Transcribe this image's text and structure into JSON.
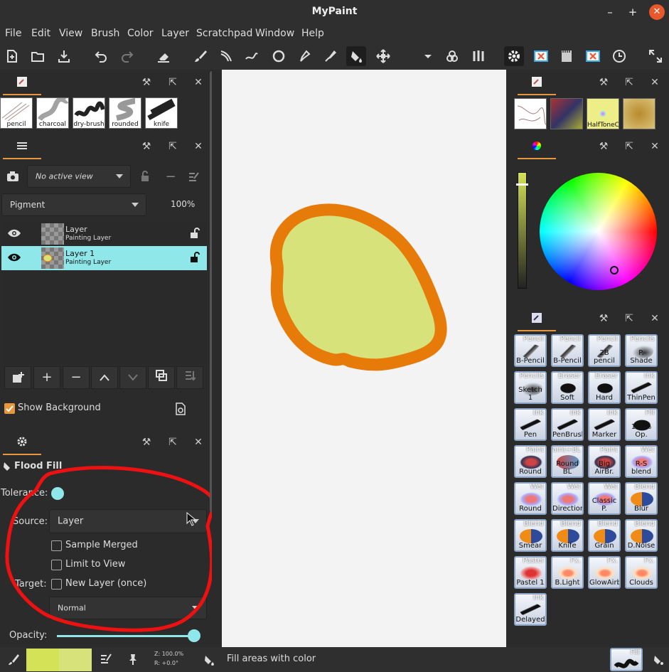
{
  "window": {
    "title": "MyPaint",
    "min": "–",
    "max": "+",
    "close": "✕"
  },
  "menu": [
    "File",
    "Edit",
    "View",
    "Brush",
    "Color",
    "Layer",
    "Scratchpad",
    "Window",
    "Help"
  ],
  "brushes_top": [
    {
      "label": "pencil"
    },
    {
      "label": "charcoal"
    },
    {
      "label": "dry-brush"
    },
    {
      "label": "rounded"
    },
    {
      "label": "knife"
    }
  ],
  "right_brushes_top": [
    {
      "label": ""
    },
    {
      "label": ""
    },
    {
      "label": "HalfToneCMY"
    },
    {
      "label": ""
    }
  ],
  "layers": {
    "view_combo": "No active view",
    "blend_mode": "Pigment",
    "opacity": "100%",
    "items": [
      {
        "name": "Layer",
        "type": "Painting Layer",
        "selected": false
      },
      {
        "name": "Layer 1",
        "type": "Painting Layer",
        "selected": true
      }
    ],
    "show_background": "Show Background"
  },
  "tool_options": {
    "title": "Flood Fill",
    "tolerance_label": "Tolerance:",
    "tolerance_value": 0.0,
    "source_label": "Source:",
    "source_value": "Layer",
    "sample_merged": "Sample Merged",
    "limit_to_view": "Limit to View",
    "target_label": "Target:",
    "new_layer": "New Layer (once)",
    "mode_value": "Normal",
    "opacity_label": "Opacity:",
    "opacity_value": 1.0
  },
  "brush_grid": [
    {
      "group": "Pencil",
      "name": "B-Pencil"
    },
    {
      "group": "Pencil",
      "name": "B-Pencil"
    },
    {
      "group": "Pencil",
      "name": "2B pencil"
    },
    {
      "group": "Pencils",
      "name": "P. Shade"
    },
    {
      "group": "Pencils",
      "name": "Sketch 1"
    },
    {
      "group": "Eraser",
      "name": "Soft"
    },
    {
      "group": "Eraser",
      "name": "Hard"
    },
    {
      "group": "Ink",
      "name": "ThinPen"
    },
    {
      "group": "Ink",
      "name": "Pen"
    },
    {
      "group": "Ink",
      "name": "PenBrush"
    },
    {
      "group": "Ink",
      "name": "Marker"
    },
    {
      "group": "Fill",
      "name": "100% Op."
    },
    {
      "group": "Paint",
      "name": "Round"
    },
    {
      "group": "Paint+BL",
      "name": "Round BL"
    },
    {
      "group": "Paint",
      "name": "Big AirBr."
    },
    {
      "group": "Wet",
      "name": "R-S blend"
    },
    {
      "group": "Wet",
      "name": "Round"
    },
    {
      "group": "Wet",
      "name": "Direction"
    },
    {
      "group": "Wet",
      "name": "Classic P."
    },
    {
      "group": "Blend",
      "name": "Blur"
    },
    {
      "group": "Blend",
      "name": "Smear"
    },
    {
      "group": "Blend",
      "name": "Knife"
    },
    {
      "group": "Blend",
      "name": "Grain"
    },
    {
      "group": "Blend",
      "name": "D.Noise"
    },
    {
      "group": "Pastel",
      "name": "Pastel 1"
    },
    {
      "group": "Fx.",
      "name": "B.Light"
    },
    {
      "group": "Fx.",
      "name": "GlowAirb"
    },
    {
      "group": "Fx.",
      "name": "Clouds"
    },
    {
      "group": "Ink",
      "name": "Delayed"
    }
  ],
  "status": {
    "zoom": "Z: 100.0%",
    "rotation": "R: +0.0°",
    "message": "Fill areas with color",
    "current_brush": "Fill"
  },
  "colors": {
    "fg": "#d4e257",
    "bg": "#d8e27a",
    "fill": "#d8e27a",
    "outline": "#e77b0a",
    "accent": "#e6963c",
    "selection": "#8fe7e9",
    "annotation": "#ee1111"
  }
}
